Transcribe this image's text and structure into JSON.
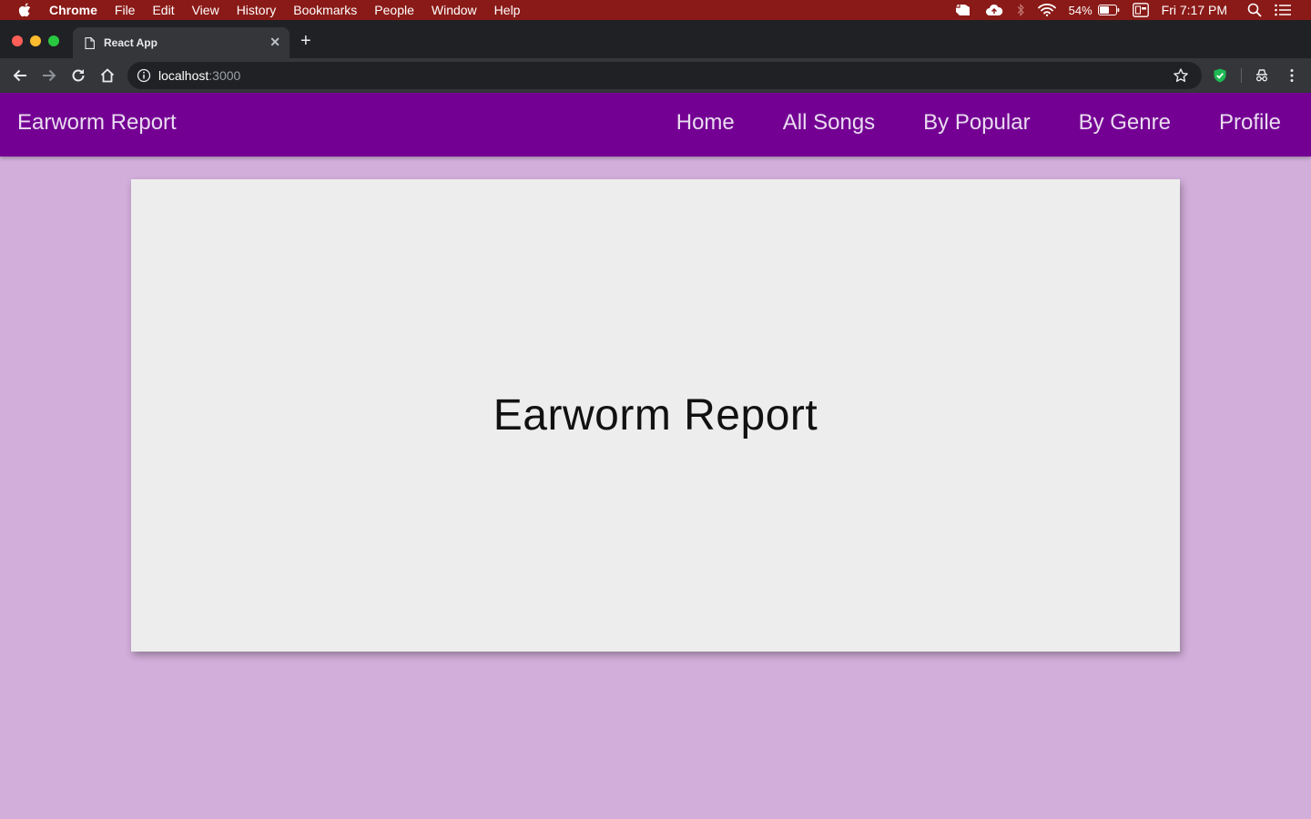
{
  "menubar": {
    "app_name": "Chrome",
    "items": [
      "File",
      "Edit",
      "View",
      "History",
      "Bookmarks",
      "People",
      "Window",
      "Help"
    ],
    "battery": "54%",
    "clock": "Fri 7:17 PM",
    "background": "#8a1a17"
  },
  "browser": {
    "tab_title": "React App",
    "url_host": "localhost",
    "url_port": ":3000"
  },
  "navbar": {
    "brand": "Earworm Report",
    "links": [
      "Home",
      "All Songs",
      "By Popular",
      "By Genre",
      "Profile"
    ],
    "background": "#730093"
  },
  "main": {
    "heading": "Earworm Report",
    "page_background": "#d2aeda",
    "card_background": "#ededed"
  },
  "icons": [
    "apple-icon",
    "evernote-icon",
    "cloud-upload-icon",
    "bluetooth-icon",
    "wifi-icon",
    "battery-icon",
    "keyboard-input-icon",
    "spotlight-search-icon",
    "notification-center-icon",
    "document-icon",
    "close-icon",
    "plus-icon",
    "back-icon",
    "forward-icon",
    "reload-icon",
    "home-icon",
    "info-icon",
    "star-icon",
    "shield-extension-icon",
    "incognito-icon",
    "kebab-menu-icon"
  ]
}
